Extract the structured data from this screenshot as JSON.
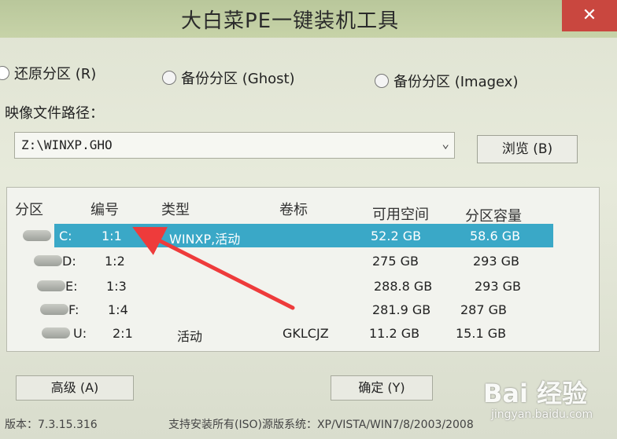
{
  "window": {
    "title": "大白菜PE一键装机工具",
    "close_glyph": "✕"
  },
  "modes": [
    {
      "label": "还原分区 (R)",
      "selected": true
    },
    {
      "label": "备份分区 (Ghost)",
      "selected": false
    },
    {
      "label": "备份分区 (Imagex)",
      "selected": false
    }
  ],
  "image_path": {
    "label": "映像文件路径：",
    "value": "Z:\\WINXP.GHO",
    "browse_label": "浏览 (B)"
  },
  "table": {
    "headers": [
      "分区",
      "编号",
      "类型",
      "卷标",
      "可用空间",
      "分区容量"
    ],
    "rows": [
      {
        "drive": "C:",
        "num": "1:1",
        "type": "WINXP,活动",
        "label": "",
        "free": "52.2 GB",
        "size": "58.6 GB",
        "selected": true
      },
      {
        "drive": "D:",
        "num": "1:2",
        "type": "",
        "label": "",
        "free": "275 GB",
        "size": "293 GB",
        "selected": false
      },
      {
        "drive": "E:",
        "num": "1:3",
        "type": "",
        "label": "",
        "free": "288.8 GB",
        "size": "293 GB",
        "selected": false
      },
      {
        "drive": "F:",
        "num": "1:4",
        "type": "",
        "label": "",
        "free": "281.9 GB",
        "size": "287 GB",
        "selected": false
      },
      {
        "drive": "U:",
        "num": "2:1",
        "type": "活动",
        "label": "GKLCJZ",
        "free": "11.2 GB",
        "size": "15.1 GB",
        "selected": false
      }
    ]
  },
  "buttons": {
    "advanced": "高级 (A)",
    "ok": "确定 (Y)"
  },
  "footer": {
    "version": "版本：7.3.15.316",
    "support": "支持安装所有(ISO)源版系统：XP/VISTA/WIN7/8/2003/2008"
  },
  "watermark": {
    "brand": "Bai 经验",
    "site": "jingyan.baidu.com"
  },
  "colors": {
    "selection": "#3aa8c7",
    "arrow": "#ee3b3b",
    "close": "#c9473f"
  }
}
